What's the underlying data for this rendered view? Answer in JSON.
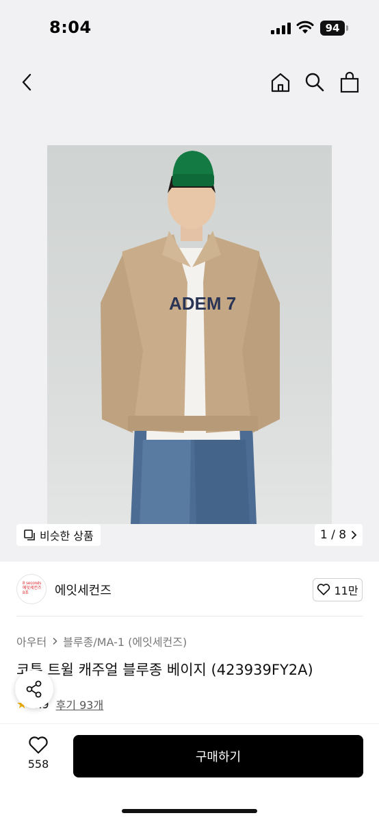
{
  "status_bar": {
    "time": "8:04",
    "battery": "94",
    "icons": [
      "signal-icon",
      "wifi-icon",
      "battery-icon"
    ]
  },
  "nav": {
    "icons": [
      "chevron-left-icon",
      "home-icon",
      "search-icon",
      "shopping-bag-icon"
    ]
  },
  "gallery": {
    "similar_label": "비슷한 상품",
    "pager": "1 / 8",
    "image_text": "ADEM 7"
  },
  "brand": {
    "logo_lines": [
      "8 seconds",
      "에잇세컨즈",
      "8초"
    ],
    "name": "에잇세컨즈",
    "likes": "11만"
  },
  "product": {
    "breadcrumb": [
      "아우터",
      "블루종/MA-1 (에잇세컨즈)"
    ],
    "title": "코튼 트윌 캐주얼 블루종 베이지 (423939FY2A)",
    "rating": "4.9",
    "reviews": "후기 93개"
  },
  "bottom_bar": {
    "wish_count": "558",
    "buy_label": "구매하기"
  },
  "colors": {
    "accent": "#000000",
    "brand_red": "#e0262b",
    "star": "#f5b400"
  }
}
